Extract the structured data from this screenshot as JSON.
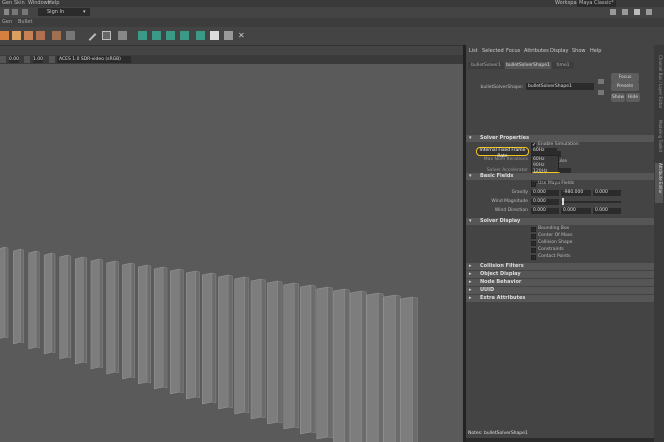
{
  "menubar": {
    "items": [
      "Gen",
      "Skin",
      "Windows",
      "Help"
    ],
    "workspace_label": "Workspace:",
    "workspace_value": "Maya Classic*"
  },
  "toolbar": {
    "signin": "Sign In"
  },
  "tabrow": {
    "items": [
      "Gen",
      "Bullet"
    ]
  },
  "viewport": {
    "cam_val1": "0.00",
    "cam_val2": "1.00",
    "color_space": "ACES 1.0 SDR-video (sRGB)"
  },
  "ae": {
    "menu": [
      "List",
      "Selected",
      "Focus",
      "Attributes",
      "Display",
      "Show",
      "Help"
    ],
    "tabs": [
      "bulletSolver1",
      "bulletSolverShape1",
      "time1"
    ],
    "node_label": "bulletSolverShape:",
    "node_value": "bulletSolverShape1",
    "focus": "Focus",
    "presets": "Presets",
    "show": "Show",
    "hide": "Hide",
    "sections": {
      "solver_properties": "Solver Properties",
      "basic_fields": "Basic Fields",
      "solver_display": "Solver Display",
      "collision_filters": "Collision Filters",
      "object_display": "Object Display",
      "node_behavior": "Node Behavior",
      "uuid": "UUID",
      "extra_attributes": "Extra Attributes"
    },
    "enable_simulation": "Enable Simulation",
    "start_time_label": "Start Time",
    "start_time_value": "1",
    "split_impulse": "Split Impulse",
    "solver_accel_label": "Solver Accelerator",
    "solver_accel_value": "None",
    "frame_rate_label": "Internal Fixed Frame Rate",
    "frame_rate_value": "60Hz",
    "max_iter_label": "Max Num Iterations",
    "dropdown": [
      "60Hz",
      "90Hz",
      "120Hz",
      "240Hz"
    ],
    "use_maya_fields": "Use Maya Fields",
    "gravity_label": "Gravity",
    "gravity": [
      "0.000",
      "-980.000",
      "0.000"
    ],
    "wind_mag_label": "Wind Magnitude",
    "wind_mag": "0.000",
    "wind_dir_label": "Wind Direction",
    "wind_dir": [
      "0.000",
      "0.000",
      "0.000"
    ],
    "display_opts": [
      "Bounding Box",
      "Center Of Mass",
      "Collision Shape",
      "Constraints",
      "Contact Points"
    ],
    "notes": "Notes: bulletSolverShape1"
  },
  "sidetabs": [
    "Channel Box / Layer Editor",
    "Modeling Toolkit",
    "Attribute Editor"
  ],
  "colors": {
    "highlight": "#f5c518",
    "selected": "#5285a6"
  }
}
